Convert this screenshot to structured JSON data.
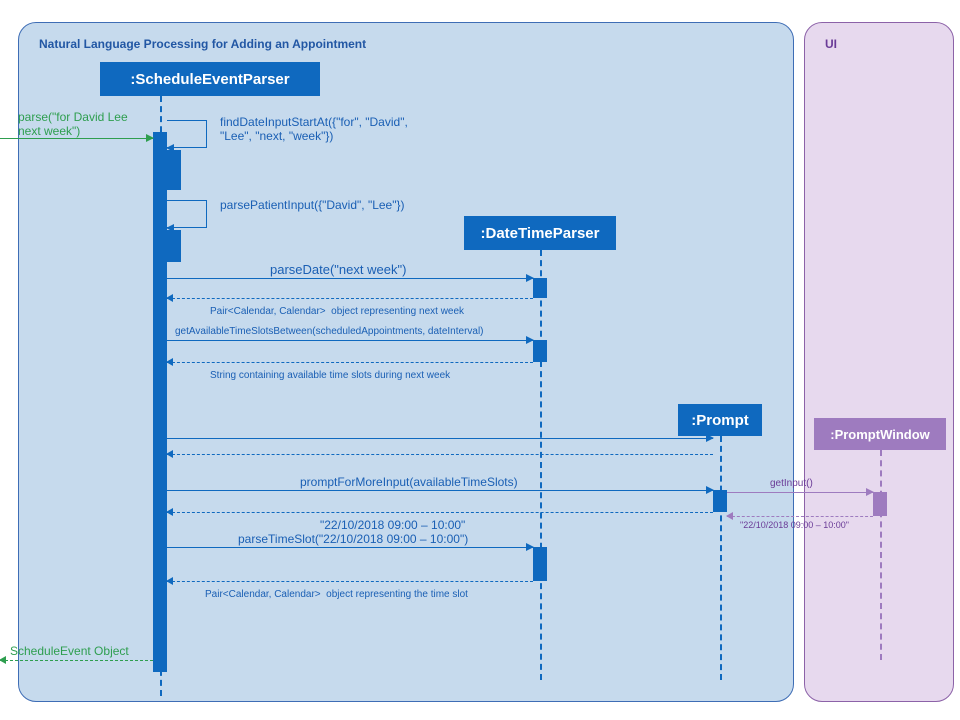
{
  "frames": {
    "nlp_title": "Natural Language Processing for Adding an Appointment",
    "ui_title": "UI"
  },
  "objects": {
    "parser": ":ScheduleEventParser",
    "dtparser": ":DateTimeParser",
    "prompt": ":Prompt",
    "pwindow": ":PromptWindow"
  },
  "messages": {
    "entry": "parse(\"for David Lee \nnext week\")",
    "m1": "findDateInputStartAt({\"for\", \"David\",\n\"Lee\", \"next, \"week\"})",
    "m2": "parsePatientInput({\"David\", \"Lee\"})",
    "m3": "parseDate(\"next week\")",
    "r3": "Pair<Calendar, Calendar>  object representing next week",
    "m4": "getAvailableTimeSlotsBetween(scheduledAppointments, dateInterval)",
    "r4": "String containing available time slots during next week",
    "m6": "promptForMoreInput(availableTimeSlots)",
    "m7": "getInput()",
    "r7": "\"22/10/2018 09:00 – 10:00\"",
    "r6": "\"22/10/2018 09:00 – 10:00\"",
    "m8": "parseTimeSlot(\"22/10/2018 09:00 – 10:00\")",
    "r8": "Pair<Calendar, Calendar>  object representing the time slot",
    "exit": "ScheduleEvent Object"
  }
}
